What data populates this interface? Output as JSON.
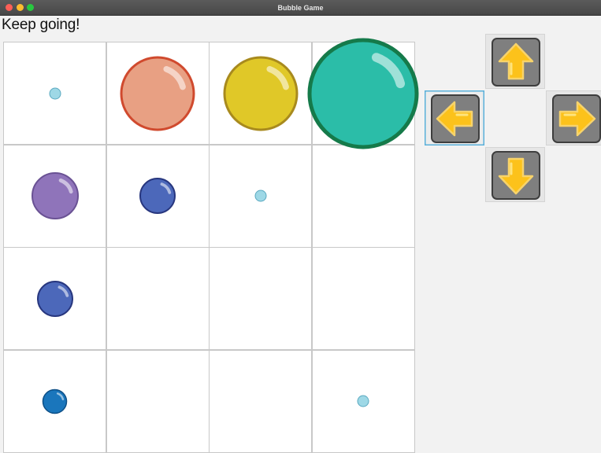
{
  "window": {
    "title": "Bubble Game"
  },
  "status": {
    "message": "Keep going!"
  },
  "board": {
    "rows": 4,
    "cols": 4,
    "bubbles": [
      {
        "row": 0,
        "col": 0,
        "size": "tiny",
        "color": "#9ed8e6",
        "border": "#5aa9c0"
      },
      {
        "row": 0,
        "col": 1,
        "size": "large",
        "color": "#e8a083",
        "border": "#d04a2e"
      },
      {
        "row": 0,
        "col": 2,
        "size": "large",
        "color": "#e0c828",
        "border": "#a88a1e"
      },
      {
        "row": 0,
        "col": 3,
        "size": "huge",
        "color": "#2bbda8",
        "border": "#157a4a"
      },
      {
        "row": 1,
        "col": 0,
        "size": "medium",
        "color": "#8f74ba",
        "border": "#6a5294"
      },
      {
        "row": 1,
        "col": 1,
        "size": "small",
        "color": "#4c68ba",
        "border": "#27367e"
      },
      {
        "row": 1,
        "col": 2,
        "size": "tiny",
        "color": "#9ed8e6",
        "border": "#5aa9c0"
      },
      {
        "row": 2,
        "col": 0,
        "size": "small",
        "color": "#4c68ba",
        "border": "#27367e"
      },
      {
        "row": 3,
        "col": 0,
        "size": "xsmall",
        "color": "#1a76bc",
        "border": "#0d4f86"
      },
      {
        "row": 3,
        "col": 3,
        "size": "tiny",
        "color": "#9ed8e6",
        "border": "#5aa9c0"
      }
    ]
  },
  "controls": {
    "up": {
      "icon": "arrow-up-icon"
    },
    "left": {
      "icon": "arrow-left-icon",
      "focused": true
    },
    "right": {
      "icon": "arrow-right-icon"
    },
    "down": {
      "icon": "arrow-down-icon"
    },
    "arrow_color": "#fcc21b",
    "tile_color": "#7f7f7f"
  }
}
